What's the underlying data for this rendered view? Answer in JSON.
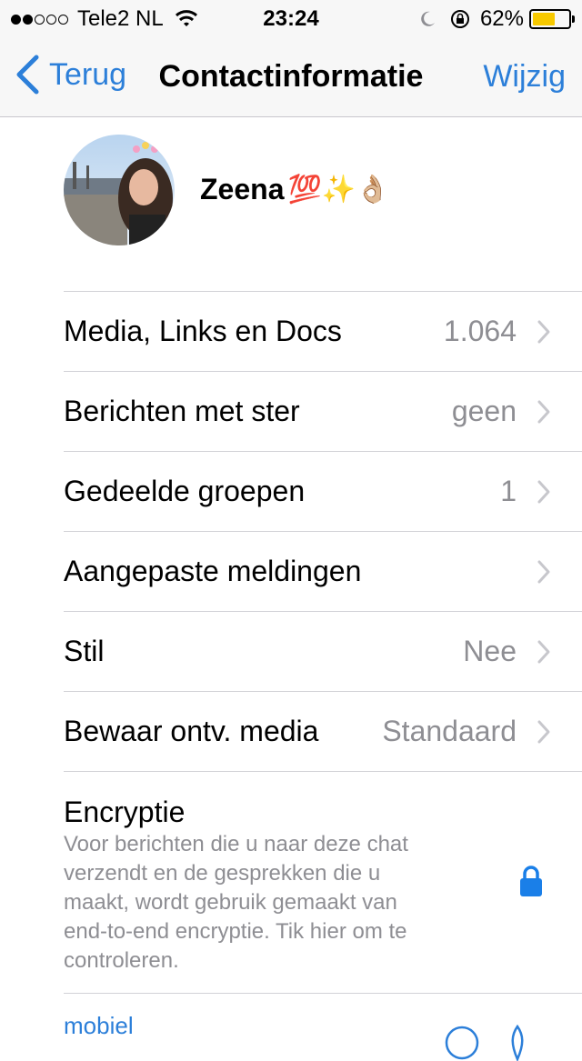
{
  "status_bar": {
    "carrier": "Tele2 NL",
    "time": "23:24",
    "battery_percent": "62%",
    "battery_level": 0.62,
    "signal_bars_filled": 2,
    "signal_bars_total": 5
  },
  "nav": {
    "back_label": "Terug",
    "title": "Contactinformatie",
    "edit_label": "Wijzig"
  },
  "profile": {
    "name": "Zeena",
    "emojis": "💯✨👌🏼"
  },
  "rows": [
    {
      "label": "Media, Links en Docs",
      "value": "1.064"
    },
    {
      "label": "Berichten met ster",
      "value": "geen"
    },
    {
      "label": "Gedeelde groepen",
      "value": "1"
    },
    {
      "label": "Aangepaste meldingen",
      "value": ""
    },
    {
      "label": "Stil",
      "value": "Nee"
    },
    {
      "label": "Bewaar ontv. media",
      "value": "Standaard"
    }
  ],
  "encryption": {
    "title": "Encryptie",
    "description": "Voor berichten die u naar deze chat verzendt en de gesprekken die u maakt, wordt gebruik gemaakt van end-to-end encryptie. Tik hier om te controleren."
  },
  "phone": {
    "type_label": "mobiel"
  },
  "colors": {
    "accent": "#2c7fd9",
    "secondary_text": "#8e8e93",
    "battery": "#f7c900"
  }
}
